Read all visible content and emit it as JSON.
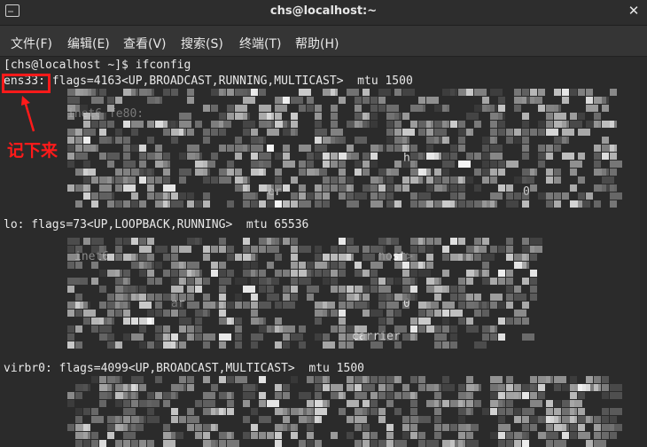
{
  "window": {
    "title": "chs@localhost:~",
    "app_icon": "terminal-icon",
    "close_glyph": "✕"
  },
  "menu": [
    {
      "label": "文件(F)"
    },
    {
      "label": "编辑(E)"
    },
    {
      "label": "查看(V)"
    },
    {
      "label": "搜索(S)"
    },
    {
      "label": "终端(T)"
    },
    {
      "label": "帮助(H)"
    }
  ],
  "terminal": {
    "prompt_line": "[chs@localhost ~]$ ifconfig",
    "ens33_name": "ens33:",
    "ens33_flags": " flags=4163<UP,BROADCAST,RUNNING,MULTICAST>  mtu 1500",
    "ens33_frag_inet": "inet6 fe80:",
    "ens33_frag_h": "h",
    "ens33_frag_er": "er",
    "ens33_frag_0": "0",
    "lo_line": "lo: flags=73<UP,LOOPBACK,RUNNING>  mtu 65536",
    "lo_frag_inet6": "inet6",
    "lo_frag_host": "host>",
    "lo_frag_ar": "ar",
    "lo_frag_0": "0",
    "lo_frag_carrier": "carrier",
    "virbr0_line": "virbr0: flags=4099<UP,BROADCAST,MULTICAST>  mtu 1500"
  },
  "annotation": {
    "text": "记下来",
    "color": "#ff1a1a"
  },
  "colors": {
    "terminal_bg": "#2b2b2b",
    "text": "#e9e9e9",
    "highlight": "#ff1a1a"
  }
}
